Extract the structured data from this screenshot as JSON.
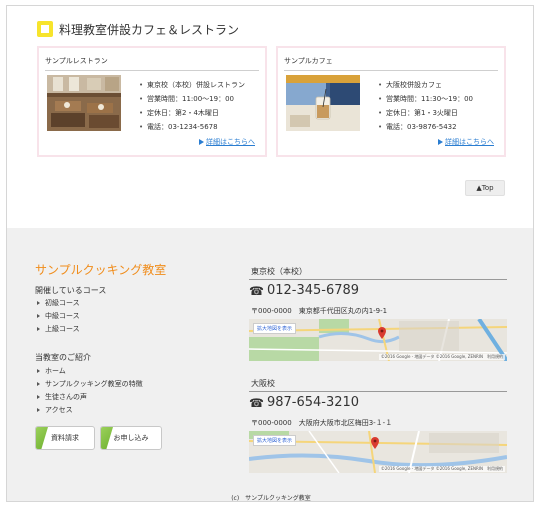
{
  "section": {
    "title": "料理教室併設カフェ＆レストラン"
  },
  "cards": [
    {
      "heading": "サンプルレストラン",
      "info": [
        "東京校（本校）併設レストラン",
        "営業時間：11:00〜19：00",
        "定休日：第2・4木曜日",
        "電話：03-1234-5678"
      ],
      "link": "詳細はこちらへ"
    },
    {
      "heading": "サンプルカフェ",
      "info": [
        "大阪校併設カフェ",
        "営業時間：11:30〜19：00",
        "定休日：第1・3火曜日",
        "電話：03-9876-5432"
      ],
      "link": "詳細はこちらへ"
    }
  ],
  "top_button": "▲Top",
  "footer": {
    "brand": "サンプルクッキング教室",
    "courses_title": "開催しているコース",
    "courses": [
      "初級コース",
      "中級コース",
      "上級コース"
    ],
    "about_title": "当教室のご紹介",
    "about": [
      "ホーム",
      "サンプルクッキング教室の特徴",
      "生徒さんの声",
      "アクセス"
    ],
    "cta_request": "資料請求",
    "cta_apply": "お申し込み",
    "offices": [
      {
        "name": "東京校（本校）",
        "phone": "012-345-6789",
        "address": "〒000-0000　東京都千代田区丸の内1-9-1",
        "map_enlarge": "拡大地図を表示",
        "map_credit": "©2016 Google - 地図データ ©2016 Google, ZENRIN　利用規約"
      },
      {
        "name": "大阪校",
        "phone": "987-654-3210",
        "address": "〒000-0000　大阪府大阪市北区梅田3-１-１",
        "map_enlarge": "拡大地図を表示",
        "map_credit": "©2016 Google - 地図データ ©2016 Google, ZENRIN　利用規約"
      }
    ],
    "copyright": "(c)　サンプルクッキング教室"
  },
  "colors": {
    "accent_orange": "#f08c1a",
    "badge_yellow": "#f7e42c",
    "card_border_pink": "#f8e3ea",
    "link_blue": "#2a7dd1",
    "cta_green": "#7cc13a"
  }
}
